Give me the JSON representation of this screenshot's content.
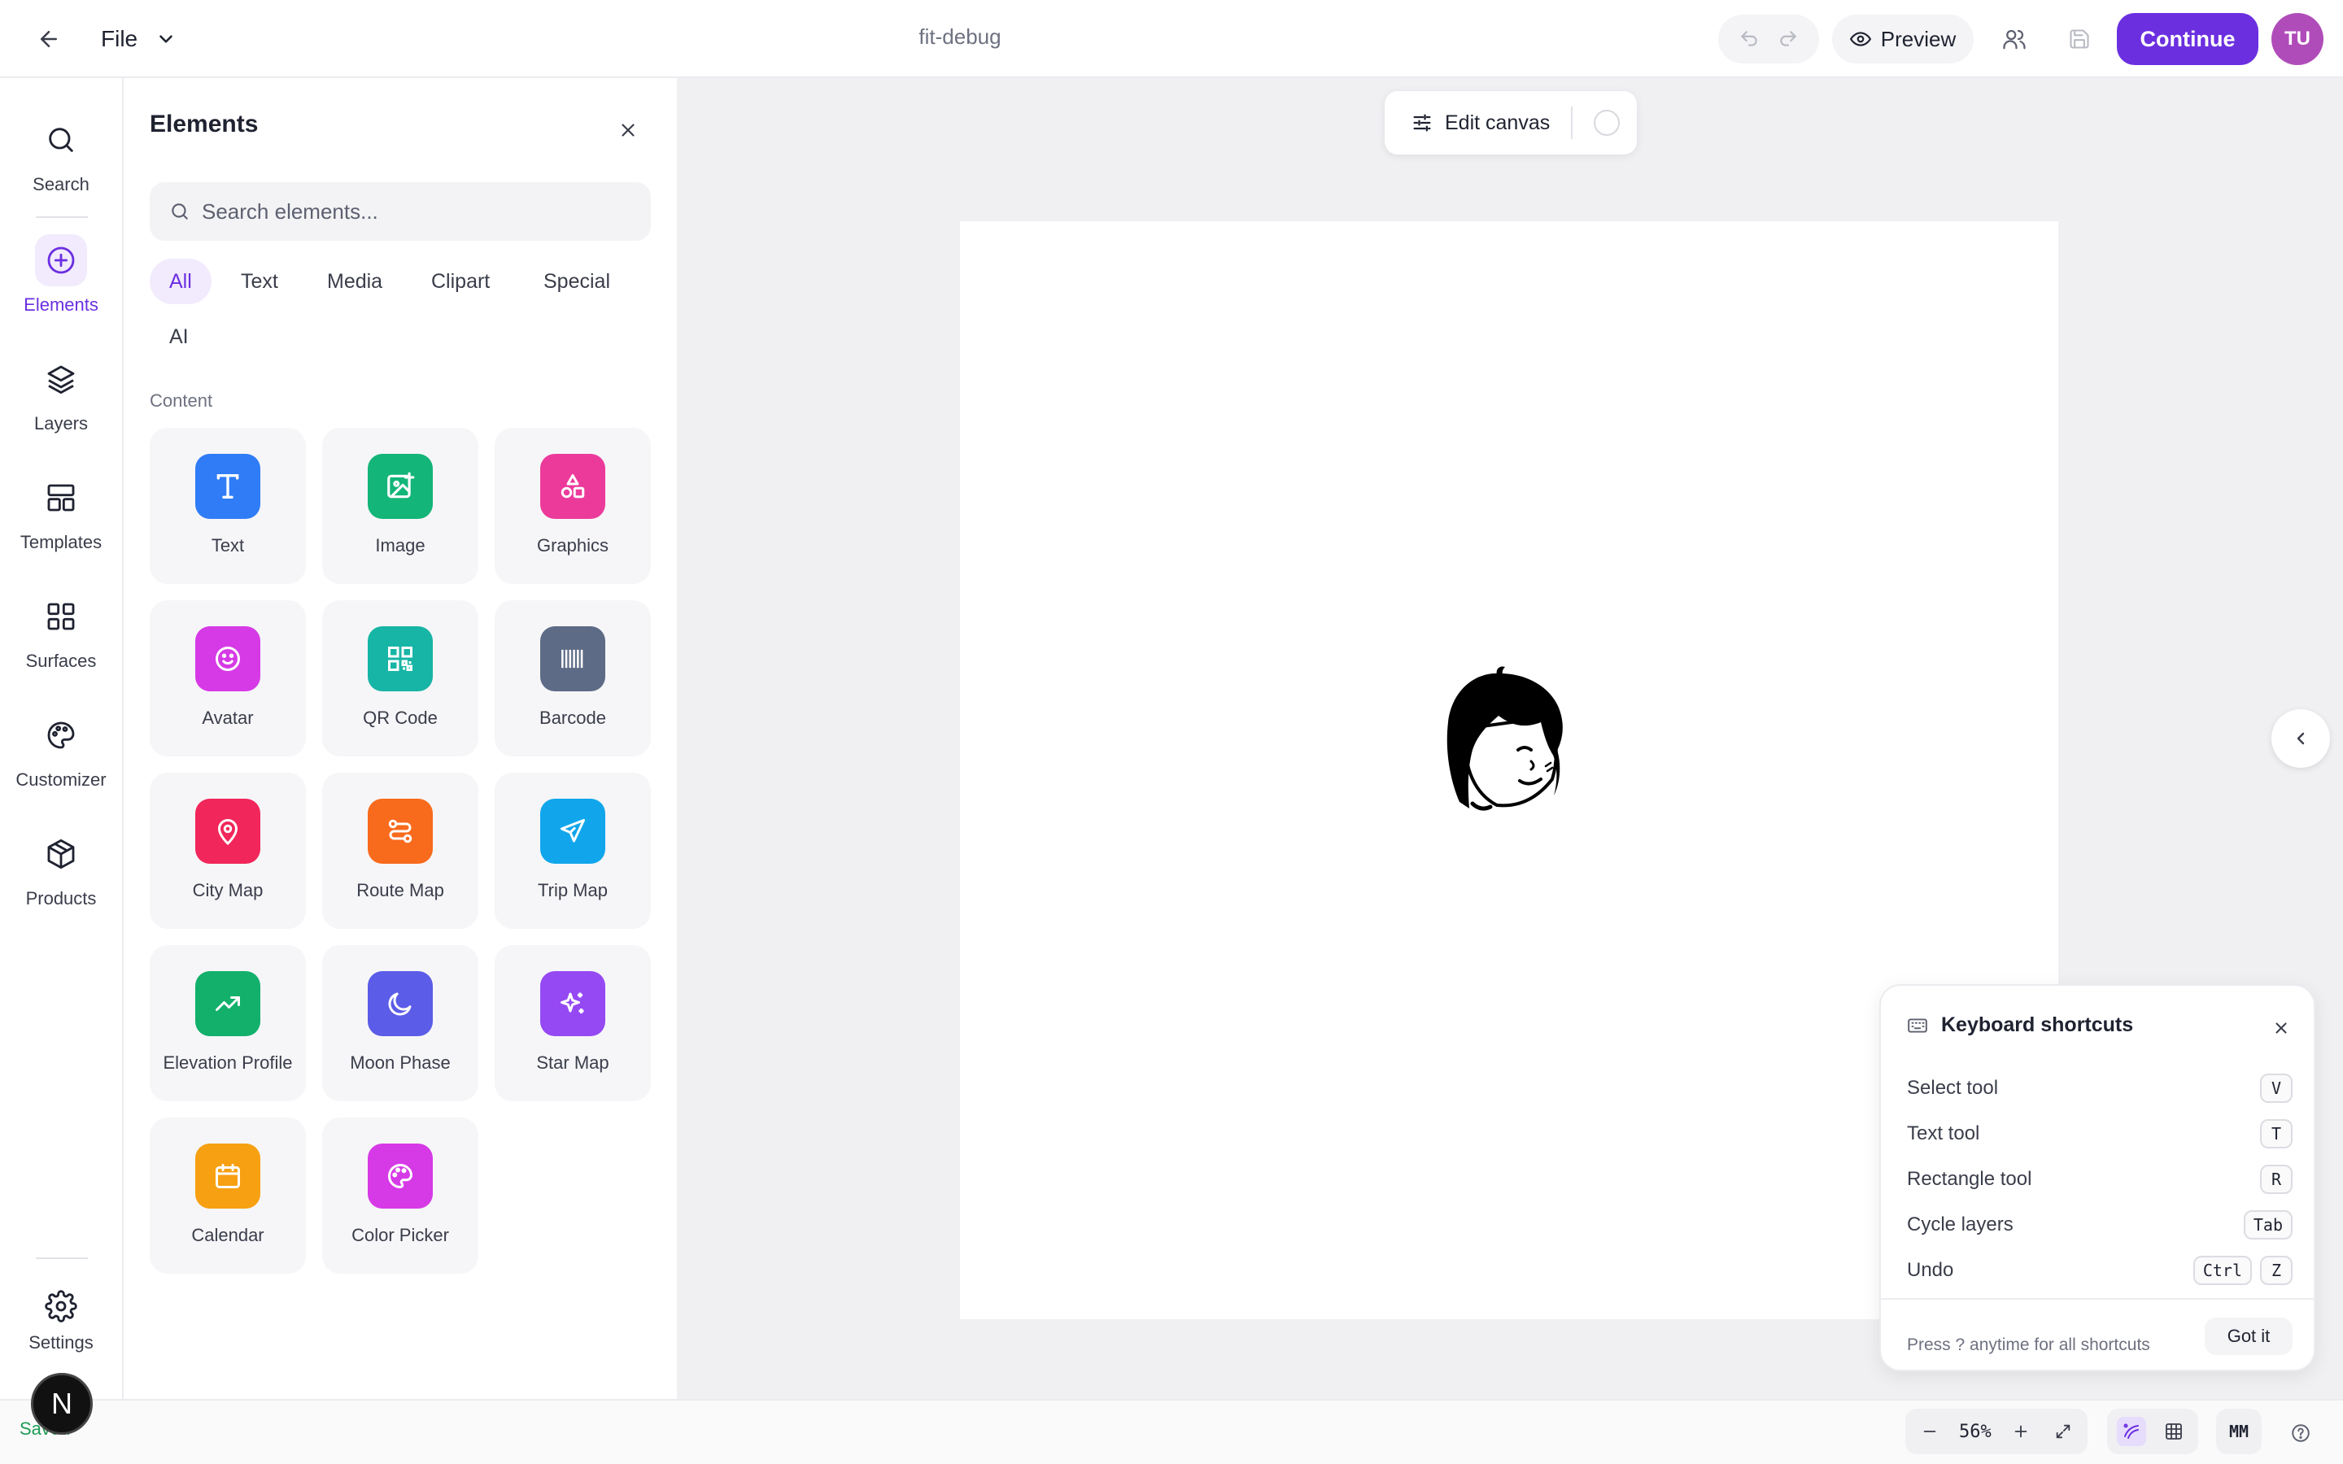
{
  "header": {
    "file_menu_label": "File",
    "document_title": "fit-debug",
    "preview_label": "Preview",
    "continue_label": "Continue",
    "user_initials": "TU"
  },
  "rail": {
    "items": [
      {
        "label": "Search",
        "icon": "search-icon"
      },
      {
        "label": "Elements",
        "icon": "plus-circle-icon",
        "active": true
      },
      {
        "label": "Layers",
        "icon": "layers-icon"
      },
      {
        "label": "Templates",
        "icon": "templates-icon"
      },
      {
        "label": "Surfaces",
        "icon": "grid-icon"
      },
      {
        "label": "Customizer",
        "icon": "palette-icon"
      },
      {
        "label": "Products",
        "icon": "box-icon"
      }
    ],
    "settings_label": "Settings",
    "saved_label": "Saved",
    "badge_letter": "N"
  },
  "panel": {
    "title": "Elements",
    "search_placeholder": "Search elements...",
    "filters": [
      "All",
      "Text",
      "Media",
      "Clipart",
      "Special",
      "AI"
    ],
    "active_filter": "All",
    "section_label": "Content",
    "tiles": [
      {
        "label": "Text",
        "color": "#2f7cf6",
        "icon": "text-icon"
      },
      {
        "label": "Image",
        "color": "#13b578",
        "icon": "image-icon"
      },
      {
        "label": "Graphics",
        "color": "#ec3a9b",
        "icon": "shapes-icon"
      },
      {
        "label": "Avatar",
        "color": "#d63ae6",
        "icon": "smiley-icon"
      },
      {
        "label": "QR Code",
        "color": "#16b5a5",
        "icon": "qr-code-icon"
      },
      {
        "label": "Barcode",
        "color": "#5d6b86",
        "icon": "barcode-icon"
      },
      {
        "label": "City Map",
        "color": "#f1265a",
        "icon": "map-pin-icon"
      },
      {
        "label": "Route Map",
        "color": "#f86a1c",
        "icon": "route-icon"
      },
      {
        "label": "Trip Map",
        "color": "#11a6ec",
        "icon": "plane-icon"
      },
      {
        "label": "Elevation Profile",
        "color": "#12b06b",
        "icon": "trending-up-icon"
      },
      {
        "label": "Moon Phase",
        "color": "#5b5ce8",
        "icon": "moon-icon"
      },
      {
        "label": "Star Map",
        "color": "#9549f2",
        "icon": "sparkles-icon"
      },
      {
        "label": "Calendar",
        "color": "#f7a012",
        "icon": "calendar-icon"
      },
      {
        "label": "Color Picker",
        "color": "#d63ae6",
        "icon": "palette-icon"
      }
    ]
  },
  "canvas": {
    "edit_canvas_label": "Edit canvas"
  },
  "shortcuts": {
    "title": "Keyboard shortcuts",
    "rows": [
      {
        "label": "Select tool",
        "keys": [
          "V"
        ]
      },
      {
        "label": "Text tool",
        "keys": [
          "T"
        ]
      },
      {
        "label": "Rectangle tool",
        "keys": [
          "R"
        ]
      },
      {
        "label": "Cycle layers",
        "keys": [
          "Tab"
        ]
      },
      {
        "label": "Undo",
        "keys": [
          "Ctrl",
          "Z"
        ]
      }
    ],
    "footer_text": "Press ? anytime for all shortcuts",
    "got_it_label": "Got it"
  },
  "footer": {
    "zoom_value": "56%",
    "unit_label": "MM"
  },
  "colors": {
    "accent": "#6b2fe0",
    "avatar_bg": "#b04cb9",
    "saved_green": "#1f9d55"
  }
}
